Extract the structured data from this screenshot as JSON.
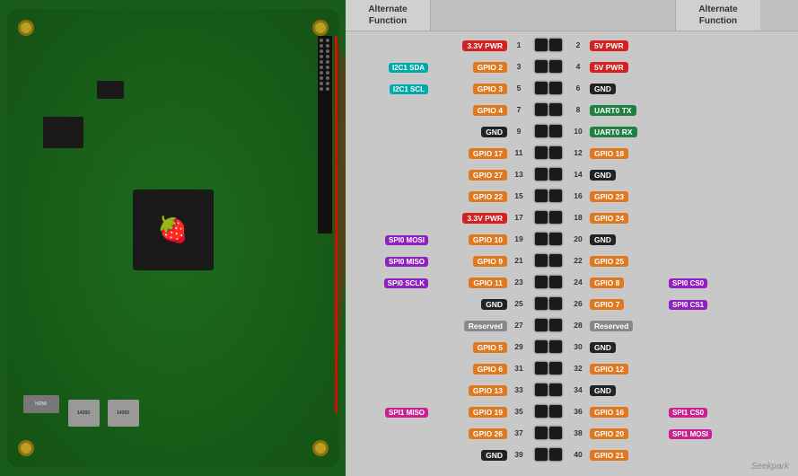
{
  "header": {
    "alt_func_left": "Alternate\nFunction",
    "alt_func_right": "Alternate\nFunction"
  },
  "pins": [
    {
      "id": 1,
      "left_num": null,
      "right_num": null,
      "left_label": "3.3V PWR",
      "left_color": "c-red",
      "right_label": "5V PWR",
      "right_color": "c-red",
      "left_pin": 1,
      "right_pin": 2,
      "left_alt": null,
      "left_alt_color": null,
      "right_alt": null,
      "right_alt_color": null
    },
    {
      "id": 2,
      "left_label": "GPIO 2",
      "left_color": "c-orange",
      "right_label": "5V PWR",
      "right_color": "c-red",
      "left_pin": 3,
      "right_pin": 4,
      "left_alt": "I2C1 SDA",
      "left_alt_color": "c-cyan",
      "right_alt": null,
      "right_alt_color": null
    },
    {
      "id": 3,
      "left_label": "GPIO 3",
      "left_color": "c-orange",
      "right_label": "GND",
      "right_color": "c-black",
      "left_pin": 5,
      "right_pin": 6,
      "left_alt": "I2C1 SCL",
      "left_alt_color": "c-cyan",
      "right_alt": null,
      "right_alt_color": null
    },
    {
      "id": 4,
      "left_label": "GPIO 4",
      "left_color": "c-orange",
      "right_label": "UART0 TX",
      "right_color": "c-green",
      "left_pin": 7,
      "right_pin": 8,
      "left_alt": null,
      "left_alt_color": null,
      "right_alt": null,
      "right_alt_color": null
    },
    {
      "id": 5,
      "left_label": "GND",
      "left_color": "c-black",
      "right_label": "UART0 RX",
      "right_color": "c-green",
      "left_pin": 9,
      "right_pin": 10,
      "left_alt": null,
      "left_alt_color": null,
      "right_alt": null,
      "right_alt_color": null
    },
    {
      "id": 6,
      "left_label": "GPIO 17",
      "left_color": "c-orange",
      "right_label": "GPIO 18",
      "right_color": "c-orange",
      "left_pin": 11,
      "right_pin": 12,
      "left_alt": null,
      "left_alt_color": null,
      "right_alt": null,
      "right_alt_color": null
    },
    {
      "id": 7,
      "left_label": "GPIO 27",
      "left_color": "c-orange",
      "right_label": "GND",
      "right_color": "c-black",
      "left_pin": 13,
      "right_pin": 14,
      "left_alt": null,
      "left_alt_color": null,
      "right_alt": null,
      "right_alt_color": null
    },
    {
      "id": 8,
      "left_label": "GPIO 22",
      "left_color": "c-orange",
      "right_label": "GPIO 23",
      "right_color": "c-orange",
      "left_pin": 15,
      "right_pin": 16,
      "left_alt": null,
      "left_alt_color": null,
      "right_alt": null,
      "right_alt_color": null
    },
    {
      "id": 9,
      "left_label": "3.3V PWR",
      "left_color": "c-red",
      "right_label": "GPIO 24",
      "right_color": "c-orange",
      "left_pin": 17,
      "right_pin": 18,
      "left_alt": null,
      "left_alt_color": null,
      "right_alt": null,
      "right_alt_color": null
    },
    {
      "id": 10,
      "left_label": "GPIO 10",
      "left_color": "c-orange",
      "right_label": "GND",
      "right_color": "c-black",
      "left_pin": 19,
      "right_pin": 20,
      "left_alt": "SPI0 MOSI",
      "left_alt_color": "c-purple",
      "right_alt": null,
      "right_alt_color": null
    },
    {
      "id": 11,
      "left_label": "GPIO 9",
      "left_color": "c-orange",
      "right_label": "GPIO 25",
      "right_color": "c-orange",
      "left_pin": 21,
      "right_pin": 22,
      "left_alt": "SPI0 MISO",
      "left_alt_color": "c-purple",
      "right_alt": null,
      "right_alt_color": null
    },
    {
      "id": 12,
      "left_label": "GPIO 11",
      "left_color": "c-orange",
      "right_label": "GPIO 8",
      "right_color": "c-orange",
      "left_pin": 23,
      "right_pin": 24,
      "left_alt": "SPI0 SCLK",
      "left_alt_color": "c-purple",
      "right_alt": "SPI0 CS0",
      "right_alt_color": "c-purple"
    },
    {
      "id": 13,
      "left_label": "GND",
      "left_color": "c-black",
      "right_label": "GPIO 7",
      "right_color": "c-orange",
      "left_pin": 25,
      "right_pin": 26,
      "left_alt": null,
      "left_alt_color": null,
      "right_alt": "SPI0 CS1",
      "right_alt_color": "c-purple"
    },
    {
      "id": 14,
      "left_label": "Reserved",
      "left_color": "c-gray",
      "right_label": "Reserved",
      "right_color": "c-gray",
      "left_pin": 27,
      "right_pin": 28,
      "left_alt": null,
      "left_alt_color": null,
      "right_alt": null,
      "right_alt_color": null
    },
    {
      "id": 15,
      "left_label": "GPIO 5",
      "left_color": "c-orange",
      "right_label": "GND",
      "right_color": "c-black",
      "left_pin": 29,
      "right_pin": 30,
      "left_alt": null,
      "left_alt_color": null,
      "right_alt": null,
      "right_alt_color": null
    },
    {
      "id": 16,
      "left_label": "GPIO 6",
      "left_color": "c-orange",
      "right_label": "GPIO 12",
      "right_color": "c-orange",
      "left_pin": 31,
      "right_pin": 32,
      "left_alt": null,
      "left_alt_color": null,
      "right_alt": null,
      "right_alt_color": null
    },
    {
      "id": 17,
      "left_label": "GPIO 13",
      "left_color": "c-orange",
      "right_label": "GND",
      "right_color": "c-black",
      "left_pin": 33,
      "right_pin": 34,
      "left_alt": null,
      "left_alt_color": null,
      "right_alt": null,
      "right_alt_color": null
    },
    {
      "id": 18,
      "left_label": "GPIO 19",
      "left_color": "c-orange",
      "right_label": "GPIO 16",
      "right_color": "c-orange",
      "left_pin": 35,
      "right_pin": 36,
      "left_alt": "SPI1 MISO",
      "left_alt_color": "c-pink",
      "right_alt": "SPI1 CS0",
      "right_alt_color": "c-pink"
    },
    {
      "id": 19,
      "left_label": "GPIO 26",
      "left_color": "c-orange",
      "right_label": "GPIO 20",
      "right_color": "c-orange",
      "left_pin": 37,
      "right_pin": 38,
      "left_alt": null,
      "left_alt_color": null,
      "right_alt": "SPI1 MOSI",
      "right_alt_color": "c-pink"
    },
    {
      "id": 20,
      "left_label": "GND",
      "left_color": "c-black",
      "right_label": "GPIO 21",
      "right_color": "c-orange",
      "left_pin": 39,
      "right_pin": 40,
      "left_alt": null,
      "left_alt_color": null,
      "right_alt": null,
      "right_alt_color": null
    }
  ],
  "watermark": "Seekpark"
}
